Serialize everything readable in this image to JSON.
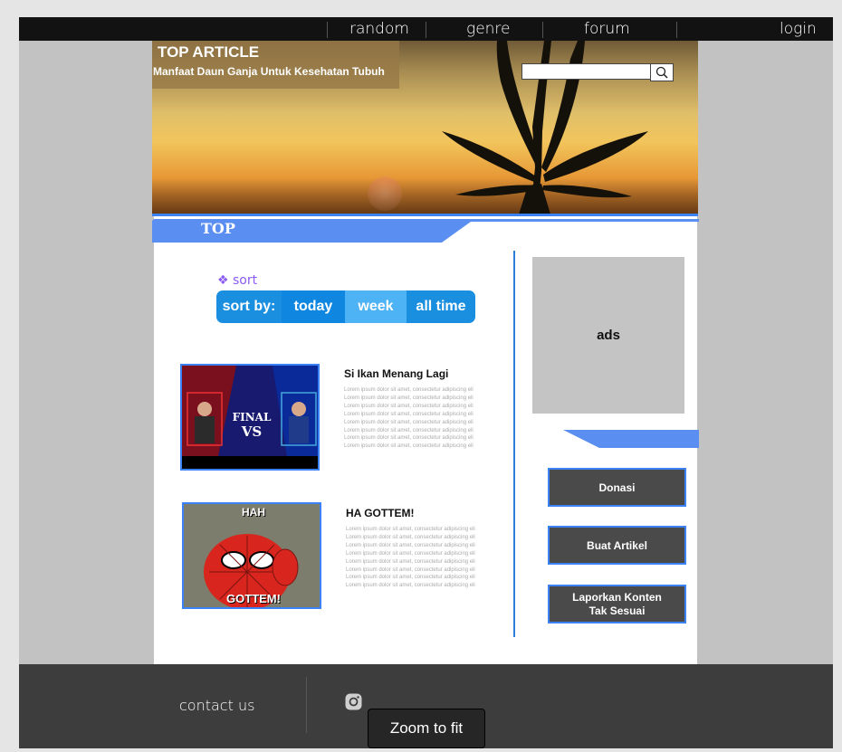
{
  "nav": {
    "items": [
      "random",
      "genre",
      "forum"
    ],
    "login": "login"
  },
  "hero": {
    "heading": "TOP ARTICLE",
    "subtitle": "Manfaat Daun Ganja Untuk Kesehatan Tubuh",
    "search_placeholder": "",
    "search_icon": "search-icon"
  },
  "section": {
    "top_label": "TOP"
  },
  "sort": {
    "label": "sort",
    "prefix": "sort by:",
    "options": [
      "today",
      "week",
      "all time"
    ],
    "selected": "week"
  },
  "articles": [
    {
      "title": "Si Ikan Menang Lagi",
      "thumb_texts": [
        "FINAL",
        "VS"
      ],
      "lorem": [
        "Lorem ipsum dolor sit amet, consectetur adipiscing eli",
        "Lorem ipsum dolor sit amet, consectetur adipiscing eli",
        "Lorem ipsum dolor sit amet, consectetur adipiscing eli",
        "Lorem ipsum dolor sit amet, consectetur adipiscing eli",
        "Lorem ipsum dolor sit amet, consectetur adipiscing eli",
        "Lorem ipsum dolor sit amet, consectetur adipiscing eli",
        "Lorem ipsum dolor sit amet, consectetur adipiscing eli",
        "Lorem ipsum dolor sit amet, consectetur adipiscing eli"
      ]
    },
    {
      "title": "HA GOTTEM!",
      "thumb_texts": [
        "HAH",
        "GOTTEM!"
      ],
      "lorem": [
        "Lorem ipsum dolor sit amet, consectetur adipiscing eli",
        "Lorem ipsum dolor sit amet, consectetur adipiscing eli",
        "Lorem ipsum dolor sit amet, consectetur adipiscing eli",
        "Lorem ipsum dolor sit amet, consectetur adipiscing eli",
        "Lorem ipsum dolor sit amet, consectetur adipiscing eli",
        "Lorem ipsum dolor sit amet, consectetur adipiscing eli",
        "Lorem ipsum dolor sit amet, consectetur adipiscing eli",
        "Lorem ipsum dolor sit amet, consectetur adipiscing eli"
      ]
    }
  ],
  "sidebar": {
    "ads_label": "ads",
    "buttons": [
      "Donasi",
      "Buat Artikel",
      "Laporkan Konten Tak Sesuai"
    ]
  },
  "footer": {
    "contact": "contact us",
    "social_icon": "instagram-icon"
  },
  "viewer": {
    "zoom_label": "Zoom to fit"
  },
  "colors": {
    "accent": "#3b82f6",
    "sortbar": "#1a8fe0",
    "sort_selected": "#4db3f5",
    "sort_label": "#8b5cf6",
    "nav_bg": "#121212",
    "footer_bg": "#3d3d3d",
    "button_bg": "#4a4a4a"
  }
}
